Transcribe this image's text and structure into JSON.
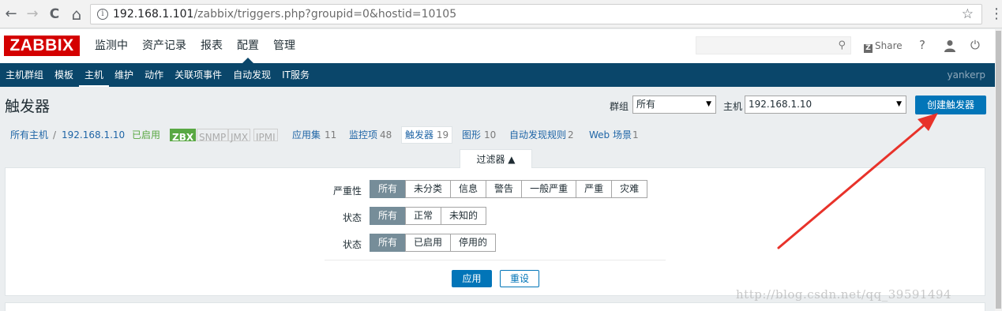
{
  "browser": {
    "back_glyph": "←",
    "forward_glyph": "→",
    "reload_glyph": "C",
    "home_glyph": "⌂",
    "info_glyph": "i",
    "url_host": "192.168.1.101",
    "url_path": "/zabbix/triggers.php?groupid=0&hostid=10105",
    "star_glyph": "☆",
    "menu_glyph": "⋮"
  },
  "header": {
    "logo": "ZABBIX",
    "menu": [
      "监测中",
      "资产记录",
      "报表",
      "配置",
      "管理"
    ],
    "active_menu_index": 3,
    "search_placeholder": "",
    "search_glyph": "⚲",
    "share_icon_glyph": "Z",
    "share_label": "Share",
    "help_glyph": "?",
    "power_glyph": "⏻"
  },
  "subnav": {
    "items": [
      "主机群组",
      "模板",
      "主机",
      "维护",
      "动作",
      "关联项事件",
      "自动发现",
      "IT服务"
    ],
    "active_index": 2,
    "user": "yankerp"
  },
  "page": {
    "title": "触发器",
    "group_label": "群组",
    "group_value": "所有",
    "host_label": "主机",
    "host_value": "192.168.1.10",
    "select_arrow": "▼",
    "create_button": "创建触发器"
  },
  "host_nav": {
    "all_hosts": "所有主机",
    "separator": "/",
    "host": "192.168.1.10",
    "enabled": "已启用",
    "tags": [
      "ZBX",
      "SNMP",
      "JMX",
      "IPMI"
    ],
    "app_label": "应用集",
    "app_count": "11",
    "items_label": "监控项",
    "items_count": "48",
    "triggers_label": "触发器",
    "triggers_count": "19",
    "graphs_label": "图形",
    "graphs_count": "10",
    "discovery_label": "自动发现规则",
    "discovery_count": "2",
    "web_label": "Web 场景",
    "web_count": "1"
  },
  "filter": {
    "tab_label": "过滤器 ▲",
    "severity_label": "严重性",
    "severity_options": [
      "所有",
      "未分类",
      "信息",
      "警告",
      "一般严重",
      "严重",
      "灾难"
    ],
    "state_label": "状态",
    "state_options": [
      "所有",
      "正常",
      "未知的"
    ],
    "status_label": "状态",
    "status_options": [
      "所有",
      "已启用",
      "停用的"
    ],
    "apply_label": "应用",
    "reset_label": "重设"
  },
  "watermark": "http://blog.csdn.net/qq_39591494",
  "colors": {
    "zabbix_red": "#d40000",
    "nav_blue": "#0a466a",
    "button_blue": "#0275b8",
    "enabled_green": "#59a843",
    "segment_active": "#768d99",
    "arrow_red": "#e8322a"
  }
}
